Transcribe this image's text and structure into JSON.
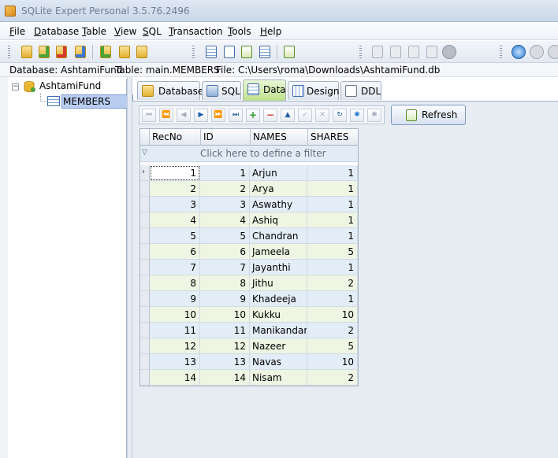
{
  "window": {
    "title": "SQLite Expert Personal 3.5.76.2496"
  },
  "menu": [
    "File",
    "Database",
    "Table",
    "View",
    "SQL",
    "Transaction",
    "Tools",
    "Help"
  ],
  "infobar": {
    "database": "Database: AshtamiFund",
    "table": "Table: main.MEMBERS",
    "file": "File: C:\\Users\\roma\\Downloads\\AshtamiFund.db"
  },
  "tree": {
    "database": "AshtamiFund",
    "table": "MEMBERS"
  },
  "tabs": [
    {
      "label": "Database",
      "icon": "database-icon"
    },
    {
      "label": "SQL",
      "icon": "sql-icon"
    },
    {
      "label": "Data",
      "icon": "data-grid-icon",
      "active": true
    },
    {
      "label": "Design",
      "icon": "design-icon"
    },
    {
      "label": "DDL",
      "icon": "ddl-icon"
    }
  ],
  "refresh_label": "Refresh",
  "grid": {
    "columns": [
      "RecNo",
      "ID",
      "NAMES",
      "SHARES"
    ],
    "filter_placeholder": "Click here to define a filter",
    "rows": [
      [
        1,
        1,
        "Arjun",
        1
      ],
      [
        2,
        2,
        "Arya",
        1
      ],
      [
        3,
        3,
        "Aswathy",
        1
      ],
      [
        4,
        4,
        "Ashiq",
        1
      ],
      [
        5,
        5,
        "Chandran",
        1
      ],
      [
        6,
        6,
        "Jameela",
        5
      ],
      [
        7,
        7,
        "Jayanthi",
        1
      ],
      [
        8,
        8,
        "Jithu",
        2
      ],
      [
        9,
        9,
        "Khadeeja",
        1
      ],
      [
        10,
        10,
        "Kukku",
        10
      ],
      [
        11,
        11,
        "Manikandan",
        2
      ],
      [
        12,
        12,
        "Nazeer",
        5
      ],
      [
        13,
        13,
        "Navas",
        10
      ],
      [
        14,
        14,
        "Nisam",
        2
      ]
    ]
  },
  "colors": {
    "active_tab": "#bfe08c",
    "row_blue": "#e3edf7",
    "row_green": "#eef5e2",
    "tree_selection": "#b8cdf0"
  }
}
